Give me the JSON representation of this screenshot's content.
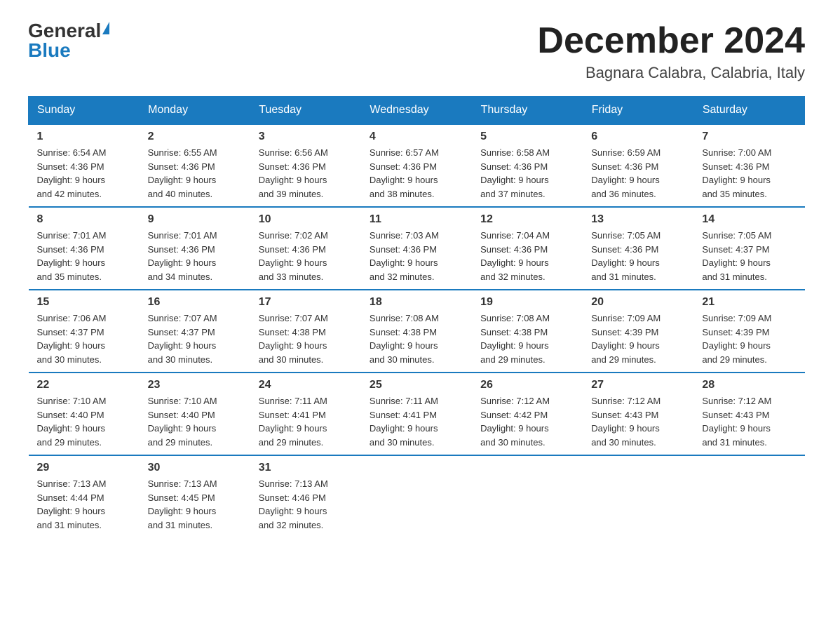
{
  "header": {
    "logo_general": "General",
    "logo_blue": "Blue",
    "month_title": "December 2024",
    "location": "Bagnara Calabra, Calabria, Italy"
  },
  "weekdays": [
    "Sunday",
    "Monday",
    "Tuesday",
    "Wednesday",
    "Thursday",
    "Friday",
    "Saturday"
  ],
  "weeks": [
    [
      {
        "day": "1",
        "sunrise": "6:54 AM",
        "sunset": "4:36 PM",
        "daylight": "9 hours and 42 minutes."
      },
      {
        "day": "2",
        "sunrise": "6:55 AM",
        "sunset": "4:36 PM",
        "daylight": "9 hours and 40 minutes."
      },
      {
        "day": "3",
        "sunrise": "6:56 AM",
        "sunset": "4:36 PM",
        "daylight": "9 hours and 39 minutes."
      },
      {
        "day": "4",
        "sunrise": "6:57 AM",
        "sunset": "4:36 PM",
        "daylight": "9 hours and 38 minutes."
      },
      {
        "day": "5",
        "sunrise": "6:58 AM",
        "sunset": "4:36 PM",
        "daylight": "9 hours and 37 minutes."
      },
      {
        "day": "6",
        "sunrise": "6:59 AM",
        "sunset": "4:36 PM",
        "daylight": "9 hours and 36 minutes."
      },
      {
        "day": "7",
        "sunrise": "7:00 AM",
        "sunset": "4:36 PM",
        "daylight": "9 hours and 35 minutes."
      }
    ],
    [
      {
        "day": "8",
        "sunrise": "7:01 AM",
        "sunset": "4:36 PM",
        "daylight": "9 hours and 35 minutes."
      },
      {
        "day": "9",
        "sunrise": "7:01 AM",
        "sunset": "4:36 PM",
        "daylight": "9 hours and 34 minutes."
      },
      {
        "day": "10",
        "sunrise": "7:02 AM",
        "sunset": "4:36 PM",
        "daylight": "9 hours and 33 minutes."
      },
      {
        "day": "11",
        "sunrise": "7:03 AM",
        "sunset": "4:36 PM",
        "daylight": "9 hours and 32 minutes."
      },
      {
        "day": "12",
        "sunrise": "7:04 AM",
        "sunset": "4:36 PM",
        "daylight": "9 hours and 32 minutes."
      },
      {
        "day": "13",
        "sunrise": "7:05 AM",
        "sunset": "4:36 PM",
        "daylight": "9 hours and 31 minutes."
      },
      {
        "day": "14",
        "sunrise": "7:05 AM",
        "sunset": "4:37 PM",
        "daylight": "9 hours and 31 minutes."
      }
    ],
    [
      {
        "day": "15",
        "sunrise": "7:06 AM",
        "sunset": "4:37 PM",
        "daylight": "9 hours and 30 minutes."
      },
      {
        "day": "16",
        "sunrise": "7:07 AM",
        "sunset": "4:37 PM",
        "daylight": "9 hours and 30 minutes."
      },
      {
        "day": "17",
        "sunrise": "7:07 AM",
        "sunset": "4:38 PM",
        "daylight": "9 hours and 30 minutes."
      },
      {
        "day": "18",
        "sunrise": "7:08 AM",
        "sunset": "4:38 PM",
        "daylight": "9 hours and 30 minutes."
      },
      {
        "day": "19",
        "sunrise": "7:08 AM",
        "sunset": "4:38 PM",
        "daylight": "9 hours and 29 minutes."
      },
      {
        "day": "20",
        "sunrise": "7:09 AM",
        "sunset": "4:39 PM",
        "daylight": "9 hours and 29 minutes."
      },
      {
        "day": "21",
        "sunrise": "7:09 AM",
        "sunset": "4:39 PM",
        "daylight": "9 hours and 29 minutes."
      }
    ],
    [
      {
        "day": "22",
        "sunrise": "7:10 AM",
        "sunset": "4:40 PM",
        "daylight": "9 hours and 29 minutes."
      },
      {
        "day": "23",
        "sunrise": "7:10 AM",
        "sunset": "4:40 PM",
        "daylight": "9 hours and 29 minutes."
      },
      {
        "day": "24",
        "sunrise": "7:11 AM",
        "sunset": "4:41 PM",
        "daylight": "9 hours and 29 minutes."
      },
      {
        "day": "25",
        "sunrise": "7:11 AM",
        "sunset": "4:41 PM",
        "daylight": "9 hours and 30 minutes."
      },
      {
        "day": "26",
        "sunrise": "7:12 AM",
        "sunset": "4:42 PM",
        "daylight": "9 hours and 30 minutes."
      },
      {
        "day": "27",
        "sunrise": "7:12 AM",
        "sunset": "4:43 PM",
        "daylight": "9 hours and 30 minutes."
      },
      {
        "day": "28",
        "sunrise": "7:12 AM",
        "sunset": "4:43 PM",
        "daylight": "9 hours and 31 minutes."
      }
    ],
    [
      {
        "day": "29",
        "sunrise": "7:13 AM",
        "sunset": "4:44 PM",
        "daylight": "9 hours and 31 minutes."
      },
      {
        "day": "30",
        "sunrise": "7:13 AM",
        "sunset": "4:45 PM",
        "daylight": "9 hours and 31 minutes."
      },
      {
        "day": "31",
        "sunrise": "7:13 AM",
        "sunset": "4:46 PM",
        "daylight": "9 hours and 32 minutes."
      },
      null,
      null,
      null,
      null
    ]
  ],
  "labels": {
    "sunrise": "Sunrise:",
    "sunset": "Sunset:",
    "daylight": "Daylight:"
  }
}
